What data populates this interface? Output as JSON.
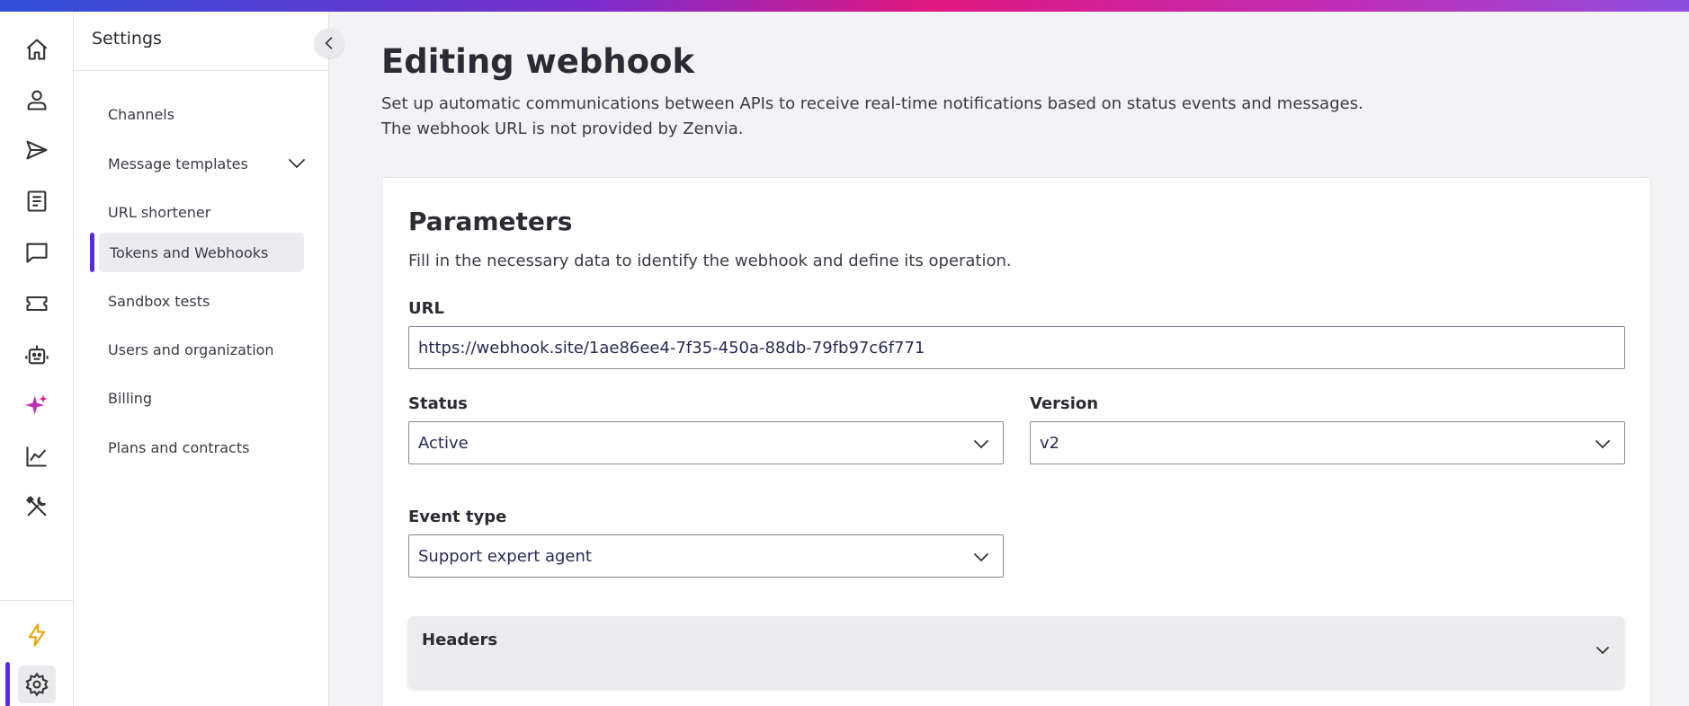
{
  "colors": {
    "accent": "#5b2be0",
    "gradient": [
      "#2f4fd6",
      "#7b2fd0",
      "#e0177f",
      "#c02fb8",
      "#8e4fe0"
    ],
    "sparkle": "#c02fb8",
    "bolt": "#e8a300"
  },
  "rail": {
    "items": [
      {
        "name": "home-icon"
      },
      {
        "name": "user-icon"
      },
      {
        "name": "send-icon"
      },
      {
        "name": "document-icon"
      },
      {
        "name": "chat-icon"
      },
      {
        "name": "ticket-icon"
      },
      {
        "name": "robot-icon"
      },
      {
        "name": "sparkle-icon"
      },
      {
        "name": "chart-icon"
      },
      {
        "name": "tools-icon"
      },
      {
        "name": "bolt-icon"
      },
      {
        "name": "gear-icon"
      }
    ]
  },
  "sidebar": {
    "title": "Settings",
    "items": [
      {
        "label": "Channels"
      },
      {
        "label": "Message templates"
      },
      {
        "label": "URL shortener"
      },
      {
        "label": "Tokens and Webhooks"
      },
      {
        "label": "Sandbox tests"
      },
      {
        "label": "Users and organization"
      },
      {
        "label": "Billing"
      },
      {
        "label": "Plans and contracts"
      }
    ]
  },
  "main": {
    "title": "Editing webhook",
    "description_line1": "Set up automatic communications between APIs to receive real-time notifications based on status events and messages.",
    "description_line2": "The webhook URL is not provided by Zenvia.",
    "card": {
      "title": "Parameters",
      "description": "Fill in the necessary data to identify the webhook and define its operation.",
      "url_label": "URL",
      "url_value": "https://webhook.site/1ae86ee4-7f35-450a-88db-79fb97c6f771",
      "status_label": "Status",
      "status_value": "Active",
      "version_label": "Version",
      "version_value": "v2",
      "event_type_label": "Event type",
      "event_type_value": "Support expert agent",
      "headers_label": "Headers"
    }
  }
}
